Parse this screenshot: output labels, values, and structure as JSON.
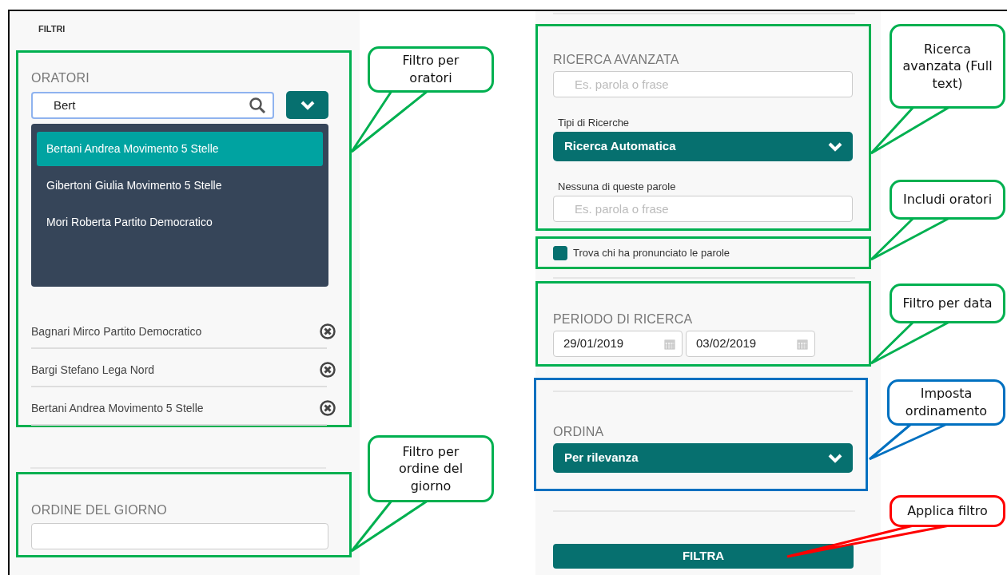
{
  "left_panel": {
    "title": "FILTRI",
    "oratori": {
      "label": "ORATORI",
      "search_value": "Bert",
      "suggestions": [
        {
          "text": "Bertani Andrea Movimento 5 Stelle",
          "selected": true
        },
        {
          "text": "Gibertoni Giulia Movimento 5 Stelle",
          "selected": false
        },
        {
          "text": "Mori Roberta Partito Democratico",
          "selected": false
        }
      ],
      "chosen": [
        "Bagnari Mirco Partito Democratico",
        "Bargi Stefano Lega Nord",
        "Bertani Andrea Movimento 5 Stelle"
      ]
    },
    "ordine_del_giorno": {
      "label": "ORDINE DEL GIORNO"
    }
  },
  "right_panel": {
    "ricerca_avanzata": {
      "label": "RICERCA AVANZATA",
      "placeholder": "Es. parola o frase",
      "tipi_label": "Tipi di Ricerche",
      "tipi_value": "Ricerca Automatica",
      "nessuna_label": "Nessuna di queste parole",
      "nessuna_placeholder": "Es. parola o frase"
    },
    "speaker_checkbox": {
      "label": "Trova chi ha pronunciato le parole",
      "checked": true
    },
    "periodo": {
      "label": "PERIODO DI RICERCA",
      "from": "29/01/2019",
      "to": "03/02/2019"
    },
    "ordina": {
      "label": "ORDINA",
      "value": "Per rilevanza"
    },
    "filter_button": "FILTRA"
  },
  "callouts": [
    {
      "text": "Filtro per oratori",
      "color": "#00b050"
    },
    {
      "text": "Filtro per ordine del giorno",
      "color": "#00b050"
    },
    {
      "text": "Ricerca avanzata (Full text)",
      "color": "#00b050"
    },
    {
      "text": "Includi oratori",
      "color": "#00b050"
    },
    {
      "text": "Filtro per data",
      "color": "#00b050"
    },
    {
      "text": "Imposta ordinamento",
      "color": "#0070c0"
    },
    {
      "text": "Applica filtro",
      "color": "#ff0000"
    }
  ]
}
